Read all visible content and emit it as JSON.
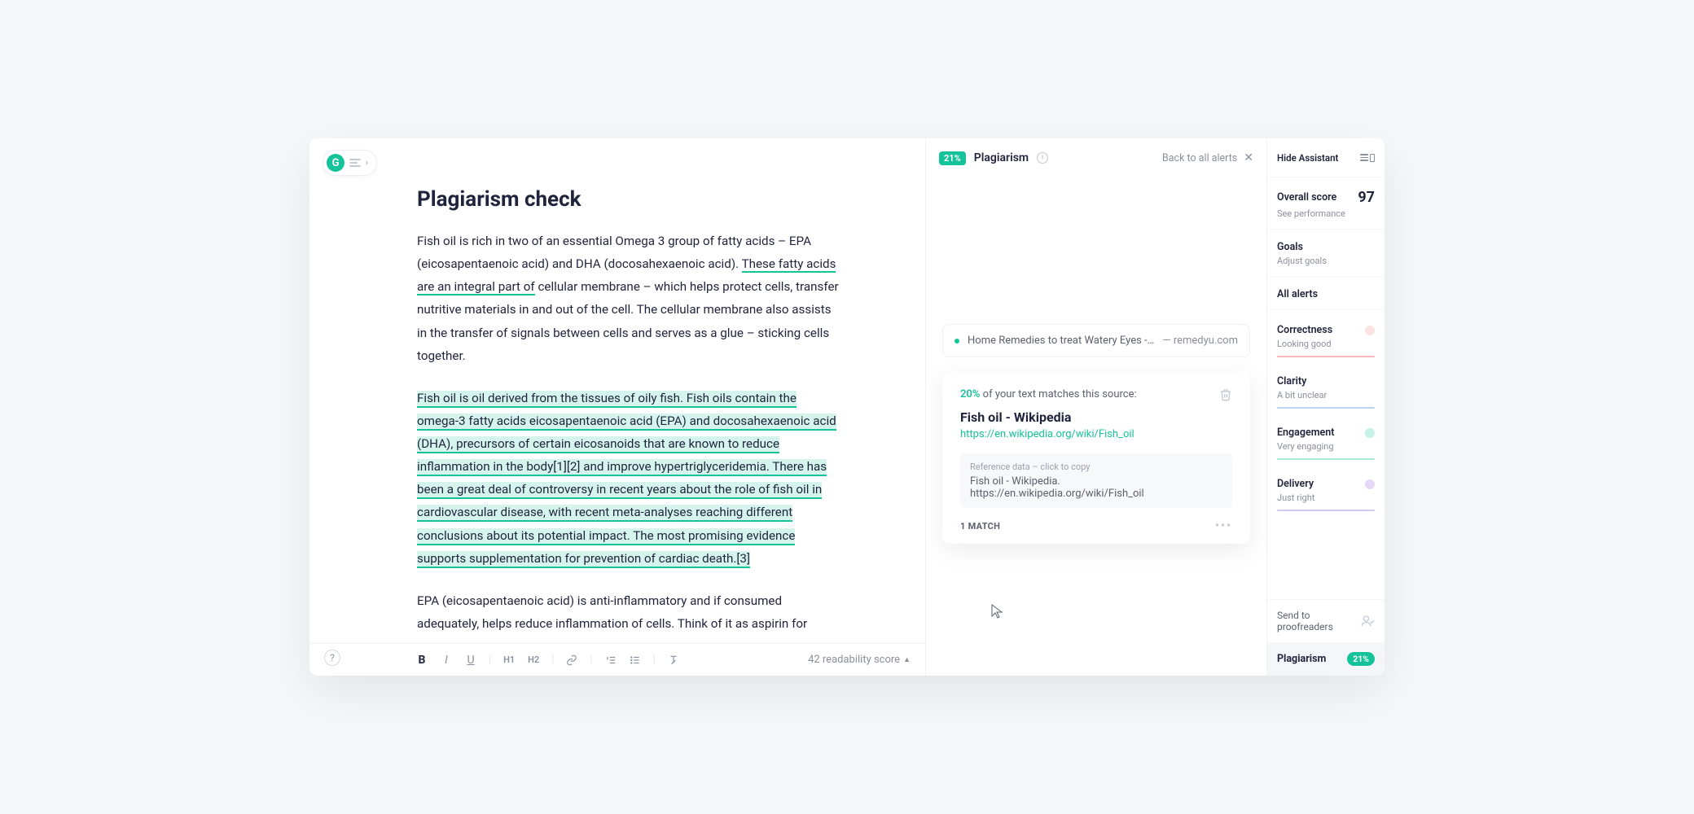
{
  "editor": {
    "title": "Plagiarism check",
    "para1_pre": "Fish oil is rich in two of an essential Omega 3 group of fatty acids – EPA (eicosapentaenoic acid) and DHA (docosahexaenoic acid). ",
    "para1_h1": "These fatty acids are an integral part of",
    "para1_post": " cellular membrane – which helps protect cells, transfer nutritive materials in and out of the cell. The cellular membrane also assists in the transfer of signals between cells and serves as a glue – sticking cells together.",
    "para2": "Fish oil is oil derived from the tissues of oily fish. Fish oils contain the omega-3 fatty acids eicosapentaenoic acid (EPA) and docosahexaenoic acid (DHA), precursors of certain eicosanoids that are known to reduce inflammation in the body[1][2] and improve hypertriglyceridemia. There has been a great deal of controversy in recent years about the role of fish oil in cardiovascular disease, with recent meta-analyses reaching different conclusions about its potential impact. The most promising evidence supports supplementation for prevention of cardiac death.[3]",
    "para3": "EPA (eicosapentaenoic acid) is anti-inflammatory and if consumed adequately, helps reduce inflammation of cells. Think of it as aspirin for",
    "readability": "42 readability score",
    "toolbar": {
      "bold": "B",
      "italic": "I",
      "underline": "U",
      "h1": "H1",
      "h2": "H2"
    }
  },
  "alerts": {
    "badge": "21%",
    "title": "Plagiarism",
    "back": "Back to all alerts",
    "source_chip": {
      "label": "Home Remedies to treat Watery Eyes - R…",
      "domain": "— remedyu.com"
    },
    "match": {
      "pct": "20%",
      "pct_text": " of your text matches this source:",
      "title": "Fish oil - Wikipedia",
      "url": "https://en.wikipedia.org/wiki/Fish_oil",
      "ref_label": "Reference data – click to copy",
      "ref_text": "Fish oil - Wikipedia. https://en.wikipedia.org/wiki/Fish_oil",
      "count": "1 MATCH"
    }
  },
  "assistant": {
    "hide": "Hide Assistant",
    "overall_label": "Overall score",
    "overall_score": "97",
    "overall_sub": "See performance",
    "goals_label": "Goals",
    "goals_sub": "Adjust goals",
    "all_alerts": "All alerts",
    "categories": {
      "correctness": {
        "title": "Correctness",
        "sub": "Looking good"
      },
      "clarity": {
        "title": "Clarity",
        "sub": "A bit unclear"
      },
      "engagement": {
        "title": "Engagement",
        "sub": "Very engaging"
      },
      "delivery": {
        "title": "Delivery",
        "sub": "Just right"
      }
    },
    "proof": "Send to proofreaders",
    "plag_label": "Plagiarism",
    "plag_pct": "21%"
  }
}
